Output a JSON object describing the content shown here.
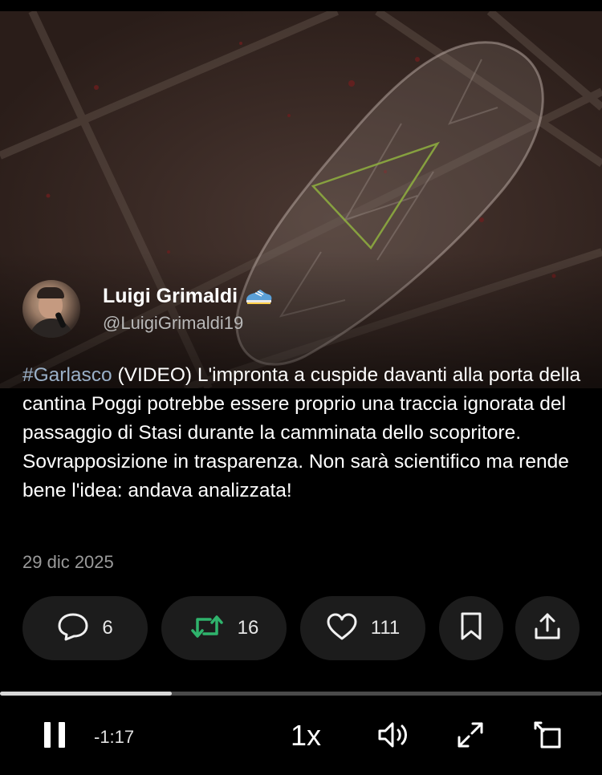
{
  "author": {
    "name": "Luigi Grimaldi",
    "handle": "@LuigiGrimaldi19",
    "badge_icon": "shoe-icon"
  },
  "tweet": {
    "hashtag": "#Garlasco",
    "body": " (VIDEO) L'impronta a cuspide davanti alla porta della cantina Poggi potrebbe essere proprio una traccia ignorata del passaggio di Stasi durante la camminata dello scopritore. Sovrapposizione in trasparenza. Non sarà scientifico ma rende bene l'idea: andava analizzata!",
    "date": "29 dic 2025"
  },
  "actions": {
    "replies": "6",
    "retweets": "16",
    "likes": "111",
    "retweet_color": "#2fb36c"
  },
  "player": {
    "progress": 0.285,
    "time_remaining": "-1:17",
    "speed": "1x"
  }
}
